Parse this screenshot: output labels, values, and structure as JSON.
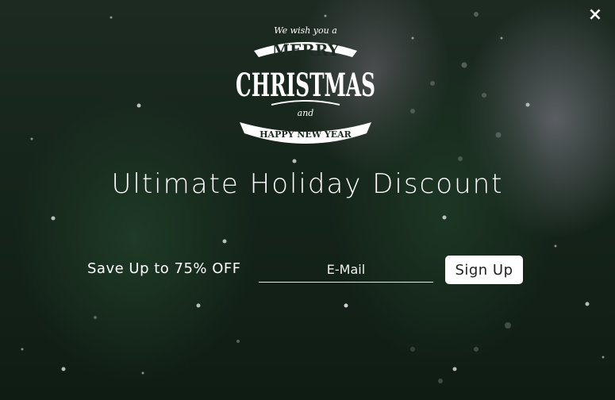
{
  "popup": {
    "close_icon": "×",
    "logo": {
      "top_line": "We wish you a",
      "line_merry": "MERRY",
      "line_christmas": "CHRISTMAS",
      "line_and": "and",
      "line_new_year": "HAPPY NEW YEAR"
    },
    "headline": "Ultimate Holiday Discount",
    "offer_text": "Save Up to 75% OFF",
    "email_placeholder": "E-Mail",
    "signup_label": "Sign Up"
  },
  "colors": {
    "text": "#ffffff",
    "button_bg": "#ffffff",
    "button_text": "#222222"
  }
}
